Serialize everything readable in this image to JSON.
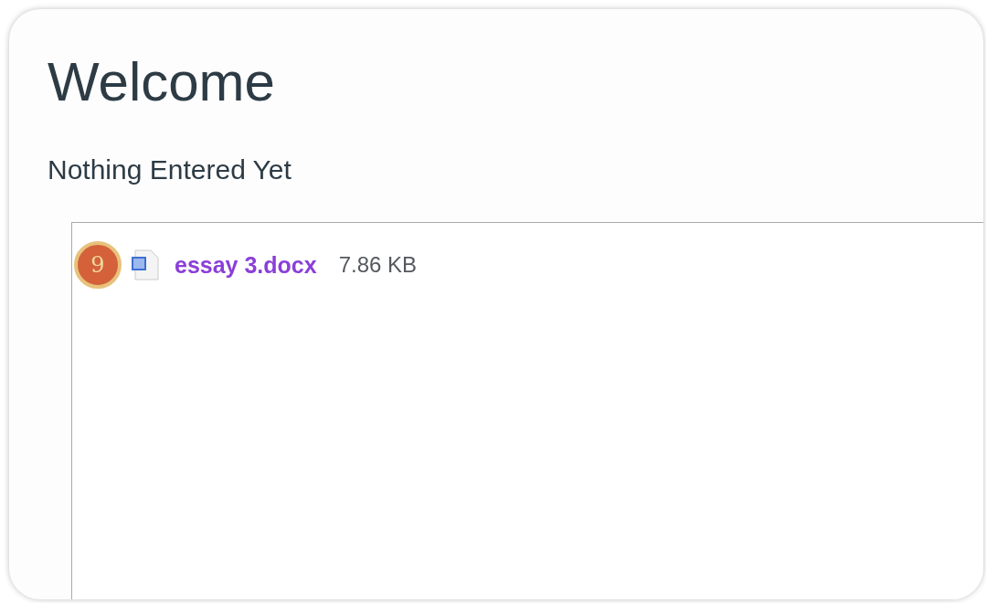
{
  "page": {
    "title": "Welcome",
    "subtitle": "Nothing Entered Yet"
  },
  "attachments": [
    {
      "marker": "9",
      "name": "essay 3.docx",
      "size": "7.86 KB"
    }
  ]
}
